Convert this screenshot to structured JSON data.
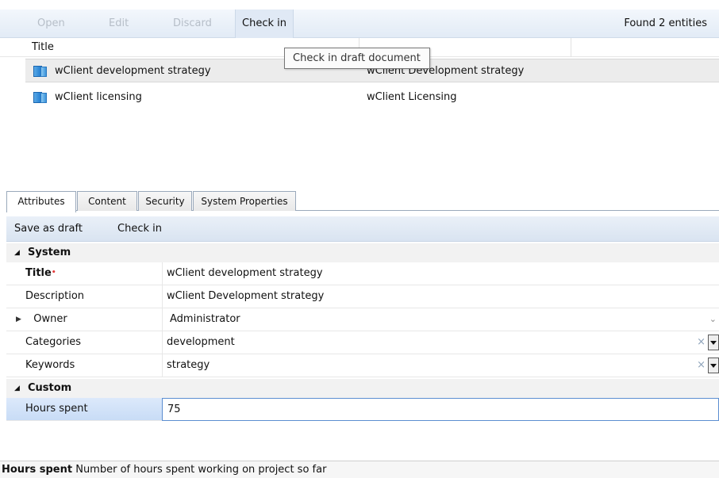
{
  "toolbar": {
    "open": "Open",
    "edit": "Edit",
    "discard": "Discard",
    "check_in": "Check in",
    "found": "Found 2 entities"
  },
  "grid": {
    "columns": [
      "Title"
    ],
    "rows": [
      {
        "name": "wClient development strategy",
        "description": "wClient Development strategy",
        "selected": true
      },
      {
        "name": "wClient licensing",
        "description": "wClient Licensing",
        "selected": false
      }
    ]
  },
  "tooltip": "Check in draft document",
  "tabs": [
    "Attributes",
    "Content",
    "Security",
    "System Properties"
  ],
  "panel_toolbar": {
    "save_as_draft": "Save as draft",
    "check_in": "Check in"
  },
  "groups": {
    "system": "System",
    "custom": "Custom"
  },
  "properties": {
    "title": {
      "label": "Title",
      "required_mark": "•",
      "value": "wClient development strategy"
    },
    "description": {
      "label": "Description",
      "value": "wClient Development strategy"
    },
    "owner": {
      "label": "Owner",
      "value": "Administrator"
    },
    "categories": {
      "label": "Categories",
      "value": "development"
    },
    "keywords": {
      "label": "Keywords",
      "value": "strategy"
    },
    "hours_spent": {
      "label": "Hours spent",
      "value": "75"
    }
  },
  "icons": {
    "collapse": "◢",
    "expand": "▶",
    "clear": "×",
    "chevron": "⌄"
  },
  "status": {
    "field": "Hours spent",
    "text": "Number of hours spent working on project so far"
  }
}
